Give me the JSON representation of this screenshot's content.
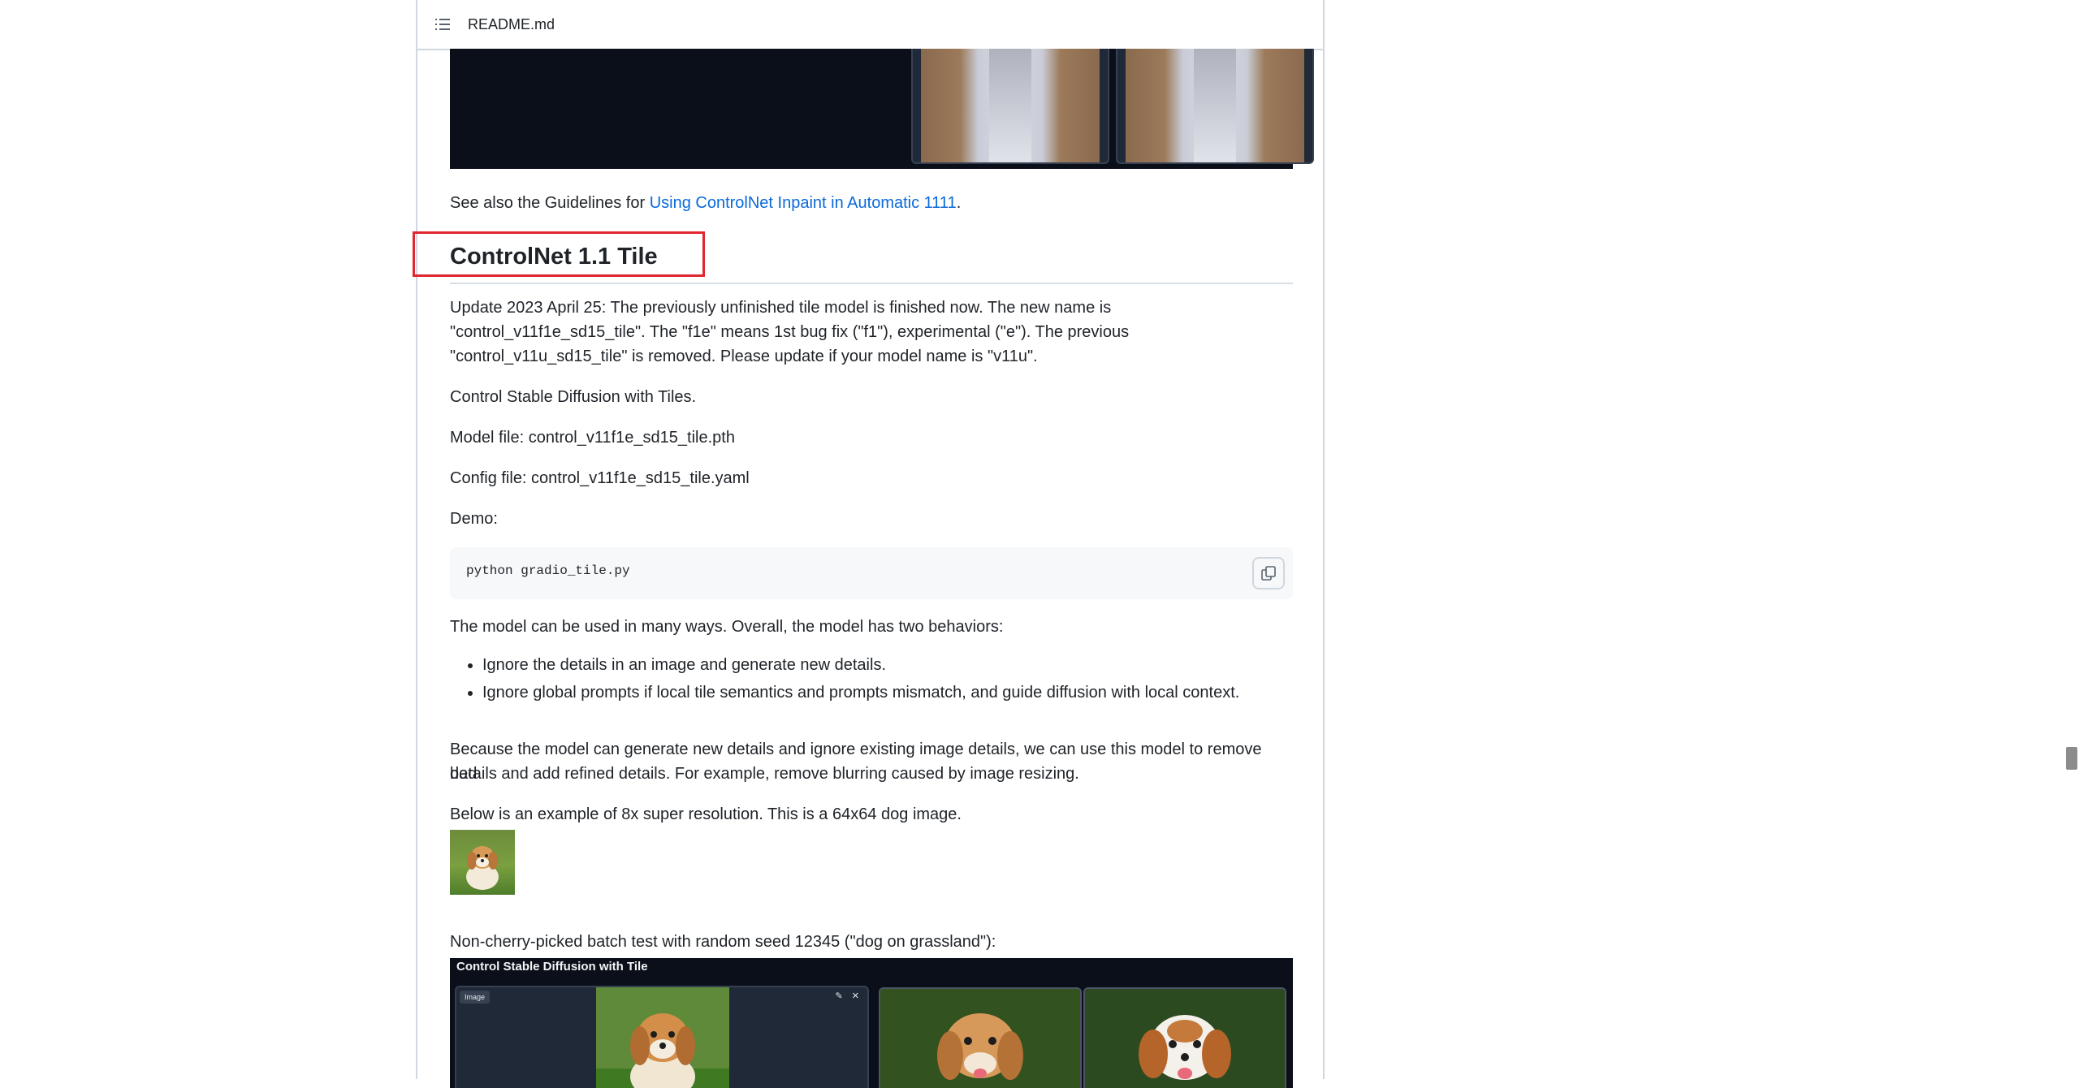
{
  "header": {
    "file_name": "README.md",
    "toc_icon": "list-unordered-icon"
  },
  "guidelines": {
    "prefix": "See also the Guidelines for ",
    "link_text": "Using ControlNet Inpaint in Automatic 1111",
    "suffix": "."
  },
  "section": {
    "heading": "ControlNet 1.1 Tile",
    "update_line1": "Update 2023 April 25: The previously unfinished tile model is finished now. The new name is",
    "update_line2": "\"control_v11f1e_sd15_tile\". The \"f1e\" means 1st bug fix (\"f1\"), experimental (\"e\"). The previous",
    "update_line3": "\"control_v11u_sd15_tile\" is removed. Please update if your model name is \"v11u\".",
    "intro": "Control Stable Diffusion with Tiles.",
    "model_file": "Model file: control_v11f1e_sd15_tile.pth",
    "config_file": "Config file: control_v11f1e_sd15_tile.yaml",
    "demo_label": "Demo:",
    "code": "python gradio_tile.py",
    "copy_icon": "copy-icon",
    "behaviors_intro": "The model can be used in many ways. Overall, the model has two behaviors:",
    "behaviors": [
      "Ignore the details in an image and generate new details.",
      "Ignore global prompts if local tile semantics and prompts mismatch, and guide diffusion with local context."
    ],
    "because_line1": "Because the model can generate new details and ignore existing image details, we can use this model to remove bad",
    "because_line2": "details and add refined details. For example, remove blurring caused by image resizing.",
    "example_intro": "Below is an example of 8x super resolution. This is a 64x64 dog image.",
    "batch_test": "Non-cherry-picked batch test with random seed 12345 (\"dog on grassland\"):"
  },
  "demo_ui": {
    "title": "Control Stable Diffusion with Tile",
    "image_tag": "Image",
    "pane_icons": "✎ ✕"
  },
  "colors": {
    "link": "#0969da",
    "highlight": "#e0262f",
    "demo_background": "#0b0f19"
  }
}
